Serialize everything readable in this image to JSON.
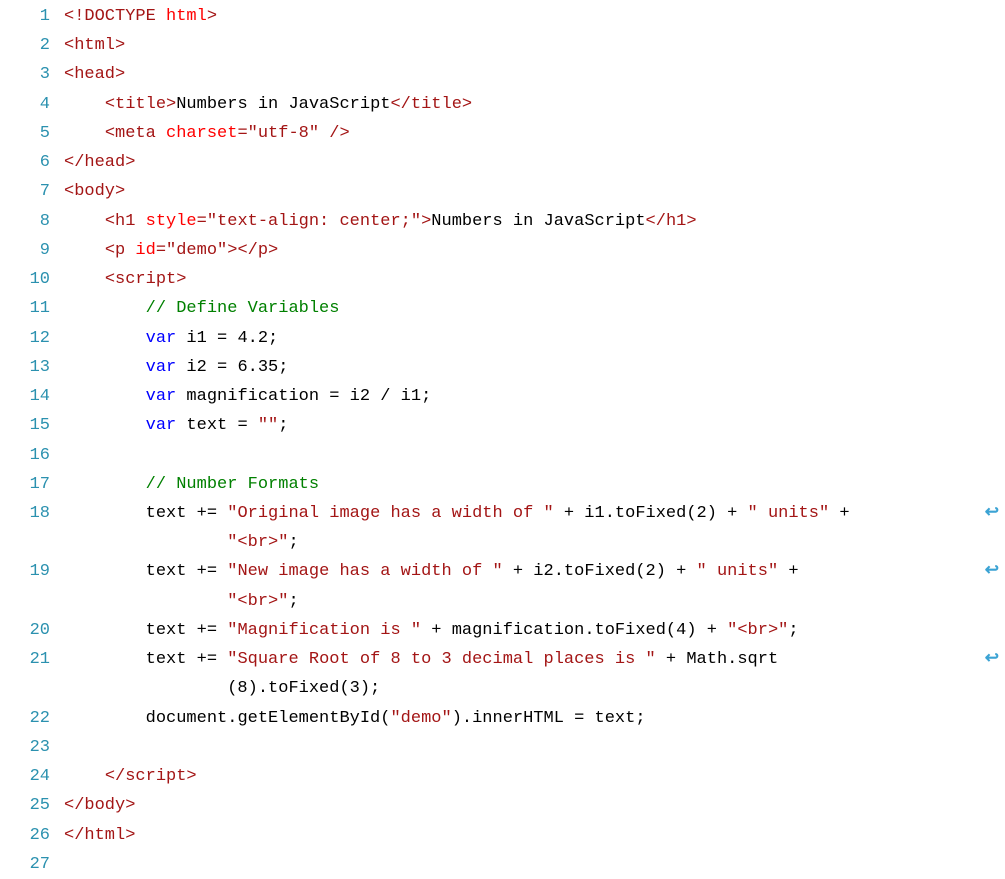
{
  "lineNumbers": [
    "1",
    "2",
    "3",
    "4",
    "5",
    "6",
    "7",
    "8",
    "9",
    "10",
    "11",
    "12",
    "13",
    "14",
    "15",
    "16",
    "17",
    "18",
    "19",
    "20",
    "21",
    "22",
    "23",
    "24",
    "25",
    "26",
    "27"
  ],
  "wrapGlyph": "↩",
  "wrapGlyphName": "line-wrap-icon",
  "codeLines": [
    {
      "indent": 0,
      "wrap": false,
      "tokens": [
        {
          "cls": "t-tag",
          "t": "<!DOCTYPE "
        },
        {
          "cls": "t-attr",
          "t": "html"
        },
        {
          "cls": "t-tag",
          "t": ">"
        }
      ]
    },
    {
      "indent": 0,
      "wrap": false,
      "tokens": [
        {
          "cls": "t-tag",
          "t": "<html>"
        }
      ]
    },
    {
      "indent": 0,
      "wrap": false,
      "tokens": [
        {
          "cls": "t-tag",
          "t": "<head>"
        }
      ]
    },
    {
      "indent": 1,
      "wrap": false,
      "tokens": [
        {
          "cls": "t-tag",
          "t": "<title>"
        },
        {
          "cls": "t-text",
          "t": "Numbers in JavaScript"
        },
        {
          "cls": "t-tag",
          "t": "</title>"
        }
      ]
    },
    {
      "indent": 1,
      "wrap": false,
      "tokens": [
        {
          "cls": "t-tag",
          "t": "<meta "
        },
        {
          "cls": "t-attr",
          "t": "charset"
        },
        {
          "cls": "t-tag",
          "t": "="
        },
        {
          "cls": "t-string",
          "t": "\"utf-8\""
        },
        {
          "cls": "t-tag",
          "t": " />"
        }
      ]
    },
    {
      "indent": 0,
      "wrap": false,
      "tokens": [
        {
          "cls": "t-tag",
          "t": "</head>"
        }
      ]
    },
    {
      "indent": 0,
      "wrap": false,
      "tokens": [
        {
          "cls": "t-tag",
          "t": "<body>"
        }
      ]
    },
    {
      "indent": 1,
      "wrap": false,
      "tokens": [
        {
          "cls": "t-tag",
          "t": "<h1 "
        },
        {
          "cls": "t-attr",
          "t": "style"
        },
        {
          "cls": "t-tag",
          "t": "="
        },
        {
          "cls": "t-string",
          "t": "\"text-align: center;\""
        },
        {
          "cls": "t-tag",
          "t": ">"
        },
        {
          "cls": "t-text",
          "t": "Numbers in JavaScript"
        },
        {
          "cls": "t-tag",
          "t": "</h1>"
        }
      ]
    },
    {
      "indent": 1,
      "wrap": false,
      "tokens": [
        {
          "cls": "t-tag",
          "t": "<p "
        },
        {
          "cls": "t-attr",
          "t": "id"
        },
        {
          "cls": "t-tag",
          "t": "="
        },
        {
          "cls": "t-string",
          "t": "\"demo\""
        },
        {
          "cls": "t-tag",
          "t": "></p>"
        }
      ]
    },
    {
      "indent": 1,
      "wrap": false,
      "tokens": [
        {
          "cls": "t-tag",
          "t": "<script>"
        }
      ]
    },
    {
      "indent": 2,
      "wrap": false,
      "tokens": [
        {
          "cls": "t-comment",
          "t": "// Define Variables"
        }
      ]
    },
    {
      "indent": 2,
      "wrap": false,
      "tokens": [
        {
          "cls": "t-keyword",
          "t": "var"
        },
        {
          "cls": "t-text",
          "t": " i1 = 4.2;"
        }
      ]
    },
    {
      "indent": 2,
      "wrap": false,
      "tokens": [
        {
          "cls": "t-keyword",
          "t": "var"
        },
        {
          "cls": "t-text",
          "t": " i2 = 6.35;"
        }
      ]
    },
    {
      "indent": 2,
      "wrap": false,
      "tokens": [
        {
          "cls": "t-keyword",
          "t": "var"
        },
        {
          "cls": "t-text",
          "t": " magnification = i2 / i1;"
        }
      ]
    },
    {
      "indent": 2,
      "wrap": false,
      "tokens": [
        {
          "cls": "t-keyword",
          "t": "var"
        },
        {
          "cls": "t-text",
          "t": " text = "
        },
        {
          "cls": "t-string",
          "t": "\"\""
        },
        {
          "cls": "t-text",
          "t": ";"
        }
      ]
    },
    {
      "indent": 2,
      "wrap": false,
      "tokens": [
        {
          "cls": "t-text",
          "t": ""
        }
      ]
    },
    {
      "indent": 2,
      "wrap": false,
      "tokens": [
        {
          "cls": "t-comment",
          "t": "// Number Formats"
        }
      ]
    },
    {
      "indent": 2,
      "wrap": true,
      "tokens": [
        {
          "cls": "t-text",
          "t": "text += "
        },
        {
          "cls": "t-string",
          "t": "\"Original image has a width of \""
        },
        {
          "cls": "t-text",
          "t": " + i1.toFixed(2) + "
        },
        {
          "cls": "t-string",
          "t": "\" units\""
        },
        {
          "cls": "t-text",
          "t": " + "
        }
      ],
      "cont": [
        {
          "cls": "t-string",
          "t": "\"<br>\""
        },
        {
          "cls": "t-text",
          "t": ";"
        }
      ]
    },
    {
      "indent": 2,
      "wrap": true,
      "tokens": [
        {
          "cls": "t-text",
          "t": "text += "
        },
        {
          "cls": "t-string",
          "t": "\"New image has a width of \""
        },
        {
          "cls": "t-text",
          "t": " + i2.toFixed(2) + "
        },
        {
          "cls": "t-string",
          "t": "\" units\""
        },
        {
          "cls": "t-text",
          "t": " + "
        }
      ],
      "cont": [
        {
          "cls": "t-string",
          "t": "\"<br>\""
        },
        {
          "cls": "t-text",
          "t": ";"
        }
      ]
    },
    {
      "indent": 2,
      "wrap": false,
      "tokens": [
        {
          "cls": "t-text",
          "t": "text += "
        },
        {
          "cls": "t-string",
          "t": "\"Magnification is \""
        },
        {
          "cls": "t-text",
          "t": " + magnification.toFixed(4) + "
        },
        {
          "cls": "t-string",
          "t": "\"<br>\""
        },
        {
          "cls": "t-text",
          "t": ";"
        }
      ]
    },
    {
      "indent": 2,
      "wrap": true,
      "tokens": [
        {
          "cls": "t-text",
          "t": "text += "
        },
        {
          "cls": "t-string",
          "t": "\"Square Root of 8 to 3 decimal places is \""
        },
        {
          "cls": "t-text",
          "t": " + Math.sqrt"
        }
      ],
      "cont": [
        {
          "cls": "t-text",
          "t": "(8).toFixed(3);"
        }
      ]
    },
    {
      "indent": 2,
      "wrap": false,
      "tokens": [
        {
          "cls": "t-text",
          "t": "document.getElementById("
        },
        {
          "cls": "t-string",
          "t": "\"demo\""
        },
        {
          "cls": "t-text",
          "t": ").innerHTML = text;"
        }
      ]
    },
    {
      "indent": 2,
      "wrap": false,
      "tokens": [
        {
          "cls": "t-text",
          "t": ""
        }
      ]
    },
    {
      "indent": 1,
      "wrap": false,
      "tokens": [
        {
          "cls": "t-tag",
          "t": "</script>"
        }
      ]
    },
    {
      "indent": 0,
      "wrap": false,
      "tokens": [
        {
          "cls": "t-tag",
          "t": "</body>"
        }
      ]
    },
    {
      "indent": 0,
      "wrap": false,
      "tokens": [
        {
          "cls": "t-tag",
          "t": "</html>"
        }
      ]
    },
    {
      "indent": 0,
      "wrap": false,
      "tokens": [
        {
          "cls": "t-text",
          "t": ""
        }
      ]
    }
  ]
}
